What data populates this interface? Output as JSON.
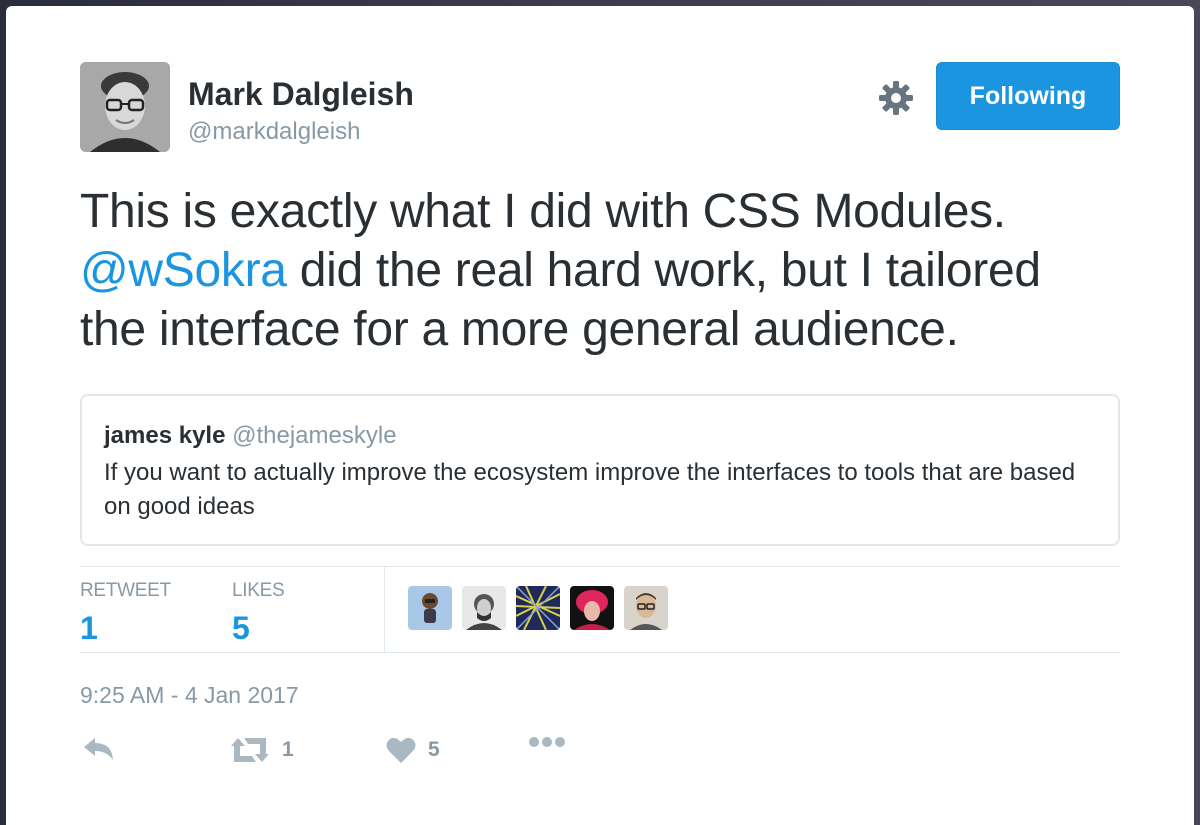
{
  "author": {
    "name": "Mark Dalgleish",
    "handle": "@markdalgleish"
  },
  "follow_button": {
    "label": "Following"
  },
  "tweet": {
    "line1": "This is exactly what I did with CSS Modules.",
    "mention": "@wSokra",
    "line2_rest": " did the real hard work, but I tailored",
    "line3": "the interface for a more general audience."
  },
  "quoted": {
    "name": "james kyle",
    "handle": "@thejameskyle",
    "text": "If you want to actually improve the ecosystem improve the interfaces to tools that are based on good ideas"
  },
  "stats": {
    "retweets": {
      "label": "RETWEET",
      "value": "1"
    },
    "likes": {
      "label": "LIKES",
      "value": "5"
    }
  },
  "likers": [
    "liker-avatar-1",
    "liker-avatar-2",
    "liker-avatar-3",
    "liker-avatar-4",
    "liker-avatar-5"
  ],
  "timestamp": "9:25 AM - 4 Jan 2017",
  "actions": {
    "retweet_count": "1",
    "like_count": "5"
  },
  "colors": {
    "accent": "#1b95e0",
    "muted": "#8899a6",
    "text": "#292f33"
  }
}
